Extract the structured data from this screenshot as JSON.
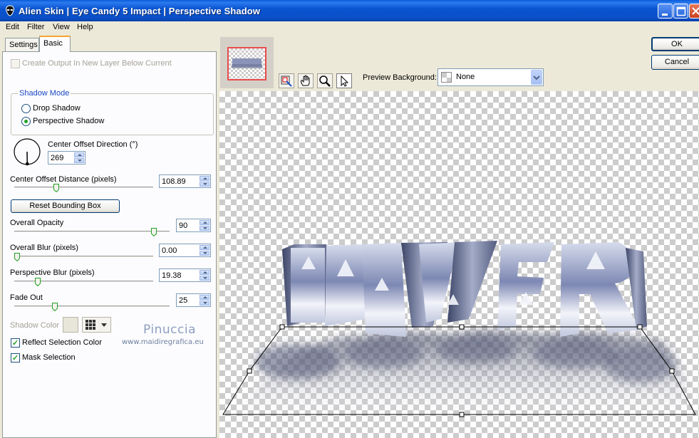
{
  "window": {
    "title": "Alien Skin | Eye Candy 5 Impact | Perspective Shadow"
  },
  "menu": [
    "Edit",
    "Filter",
    "View",
    "Help"
  ],
  "tabs": [
    {
      "label": "Settings",
      "active": false
    },
    {
      "label": "Basic",
      "active": true
    }
  ],
  "basic": {
    "create_output_label": "Create Output In New Layer Below Current",
    "create_output_checked": false,
    "shadow_mode": {
      "title": "Shadow Mode",
      "options": [
        "Drop Shadow",
        "Perspective Shadow"
      ],
      "selected": "Perspective Shadow"
    },
    "center_offset_direction": {
      "label": "Center Offset Direction (°)",
      "value": "269"
    },
    "center_offset_distance": {
      "label": "Center Offset Distance (pixels)",
      "value": "108.89",
      "slider_fraction": 0.29
    },
    "reset_button": "Reset Bounding Box",
    "overall_opacity": {
      "label": "Overall Opacity",
      "value": "90",
      "slider_fraction": 0.9
    },
    "overall_blur": {
      "label": "Overall Blur (pixels)",
      "value": "0.00",
      "slider_fraction": 0.0
    },
    "perspective_blur": {
      "label": "Perspective Blur (pixels)",
      "value": "19.38",
      "slider_fraction": 0.16
    },
    "fade_out": {
      "label": "Fade Out",
      "value": "25",
      "slider_fraction": 0.25
    },
    "shadow_color_label": "Shadow Color",
    "shadow_color": "#E8E6D8",
    "reflect_selection_color": {
      "label": "Reflect Selection Color",
      "checked": true
    },
    "mask_selection": {
      "label": "Mask Selection",
      "checked": true
    }
  },
  "watermark": {
    "name": "Pinuccia",
    "site": "www.maidiregrafica.eu"
  },
  "preview": {
    "background_label": "Preview Background:",
    "background_value": "None",
    "tools": [
      "navigator-icon",
      "hand-icon",
      "zoom-icon",
      "arrow-icon"
    ],
    "active_tool": "arrow-icon"
  },
  "buttons": {
    "ok": "OK",
    "cancel": "Cancel"
  },
  "colors": {
    "titlebar": "#0A55D0",
    "accent_green": "#21A121",
    "group_title": "#1B48C4"
  }
}
